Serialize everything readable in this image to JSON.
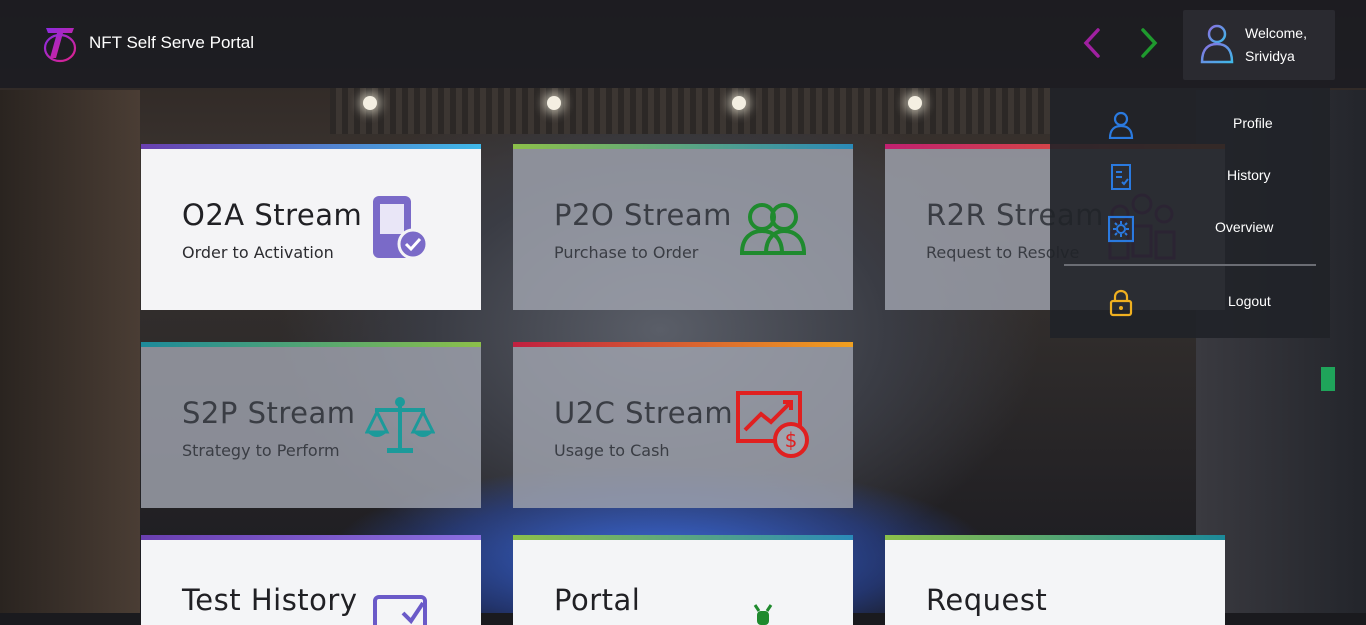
{
  "header": {
    "brand": "NFT Self Serve Portal",
    "welcome_line1": "Welcome,",
    "welcome_line2": "Srividya",
    "back_icon": "chevron-left-icon",
    "forward_icon": "chevron-right-icon"
  },
  "cards": [
    {
      "title": "O2A Stream",
      "subtitle": "Order to Activation",
      "icon": "device-check-icon",
      "accent": "#6a4fbf"
    },
    {
      "title": "P2O Stream",
      "subtitle": "Purchase to Order",
      "icon": "users-icon",
      "accent": "#1f8a2e"
    },
    {
      "title": "R2R Stream",
      "subtitle": "Request to Resolve",
      "icon": "people-tasks-icon",
      "accent": "#a64fb6"
    },
    {
      "title": "S2P Stream",
      "subtitle": "Strategy to Perform",
      "icon": "scales-icon",
      "accent": "#1c9a9a"
    },
    {
      "title": "U2C Stream",
      "subtitle": "Usage to Cash",
      "icon": "chart-dollar-icon",
      "accent": "#e02020"
    },
    {
      "title": "Test History",
      "subtitle": "",
      "icon": "checklist-icon",
      "accent": "#6a4fbf"
    },
    {
      "title": "Portal",
      "subtitle": "",
      "icon": "bug-icon",
      "accent": "#1f8a2e"
    },
    {
      "title": "Request",
      "subtitle": "",
      "icon": "",
      "accent": "#1c9a9a"
    }
  ],
  "user_menu": {
    "items": [
      {
        "label": "Profile",
        "icon": "user-icon"
      },
      {
        "label": "History",
        "icon": "document-check-icon"
      },
      {
        "label": "Overview",
        "icon": "gear-icon"
      },
      {
        "label": "Logout",
        "icon": "lock-icon"
      }
    ]
  }
}
